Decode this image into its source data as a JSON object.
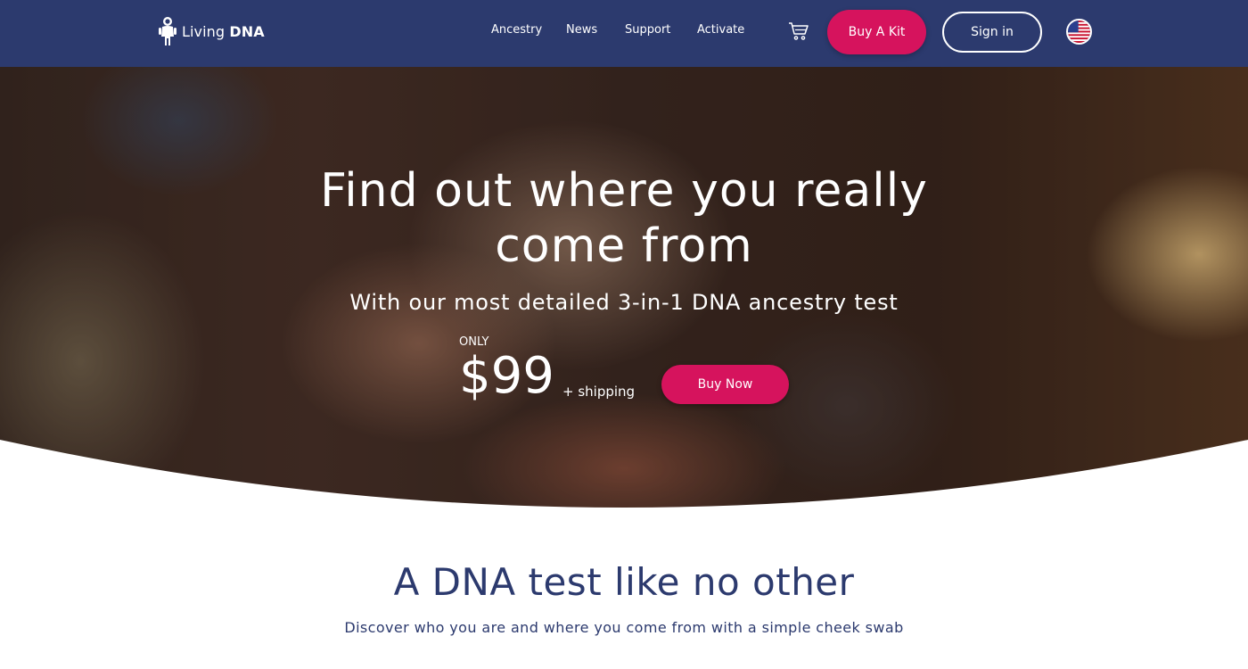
{
  "brand": {
    "name_prefix": "Living",
    "name_bold": "DNA"
  },
  "nav": {
    "links": [
      {
        "label": "Ancestry"
      },
      {
        "label": "News"
      },
      {
        "label": "Support"
      },
      {
        "label": "Activate"
      }
    ],
    "buy_kit_label": "Buy A Kit",
    "sign_in_label": "Sign in"
  },
  "hero": {
    "title": "Find out where you really come from",
    "subtitle": "With our most detailed 3-in-1 DNA ancestry test",
    "price_prefix": "ONLY",
    "price": "$99",
    "shipping": "+ shipping",
    "buy_now_label": "Buy Now"
  },
  "section": {
    "title": "A DNA test like no other",
    "subtitle": "Discover who you are and where you come from with a simple cheek swab"
  },
  "colors": {
    "nav_bg": "#2c3a6e",
    "accent": "#d6135d",
    "heading": "#2c3a6e"
  },
  "icons": {
    "logo": "astronaut-logo-icon",
    "cart": "cart-icon",
    "flag": "us-flag-icon"
  }
}
